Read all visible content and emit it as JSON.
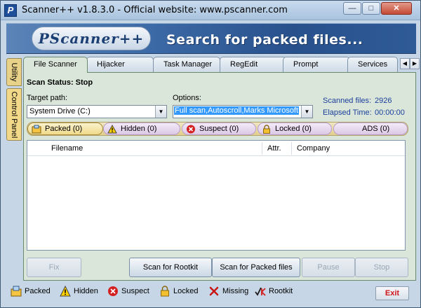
{
  "window": {
    "title": "Scanner++ v1.8.3.0  -  Official website: www.pscanner.com",
    "min_glyph": "—",
    "max_glyph": "□",
    "close_glyph": "✕"
  },
  "banner": {
    "logo": "PScanner++",
    "slogan": "Search for packed files..."
  },
  "side_tabs": [
    "Utility",
    "Control Panel"
  ],
  "tabs": [
    "File Scanner",
    "Hijacker",
    "Task Manager",
    "RegEdit",
    "Prompt",
    "Services"
  ],
  "tab_scroll": {
    "left": "◀",
    "right": "▶"
  },
  "scan": {
    "status": "Scan Status: Stop",
    "target_label": "Target path:",
    "target_value": "System Drive (C:)",
    "options_label": "Options:",
    "options_value": "Full scan,Autoscroll,Marks Microsoft",
    "scanned_label": "Scanned files:",
    "scanned_value": "2926",
    "elapsed_label": "Elapsed Time:",
    "elapsed_value": "00:00:00",
    "dropdown_glyph": "▼"
  },
  "filters": [
    {
      "label": "Packed (0)",
      "icon": "packed-icon"
    },
    {
      "label": "Hidden (0)",
      "icon": "warning-icon"
    },
    {
      "label": "Suspect (0)",
      "icon": "suspect-icon"
    },
    {
      "label": "Locked (0)",
      "icon": "lock-icon"
    },
    {
      "label": "ADS (0)",
      "icon": "ads-icon"
    }
  ],
  "table": {
    "columns": [
      "Filename",
      "Attr.",
      "Company"
    ]
  },
  "buttons": {
    "fix": "Fix",
    "scan_rootkit": "Scan for Rootkit",
    "scan_packed": "Scan for Packed files",
    "pause": "Pause",
    "stop": "Stop"
  },
  "legend": [
    {
      "label": "Packed",
      "icon": "packed-icon"
    },
    {
      "label": "Hidden",
      "icon": "warning-icon"
    },
    {
      "label": "Suspect",
      "icon": "suspect-icon"
    },
    {
      "label": "Locked",
      "icon": "lock-icon"
    },
    {
      "label": "Missing",
      "icon": "missing-icon"
    },
    {
      "label": "Rootkit",
      "icon": "rootkit-icon"
    }
  ],
  "exit": "Exit",
  "colors": {
    "stat_text": "#1c3f9c",
    "exit_text": "#d0141a",
    "panel_bg": "#d9e6d9"
  }
}
